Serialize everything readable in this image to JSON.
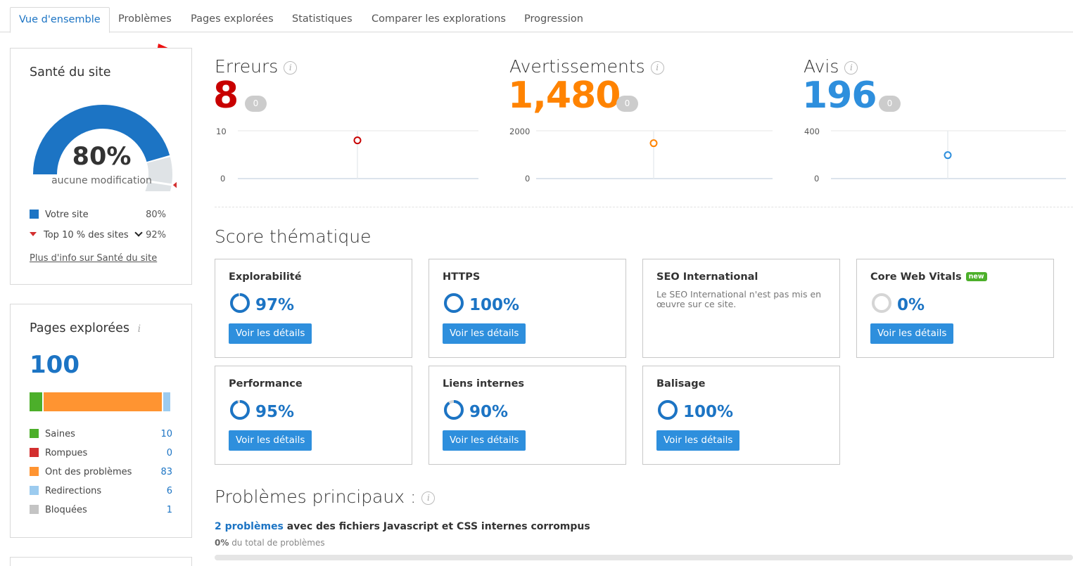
{
  "tabs": [
    {
      "label": "Vue d'ensemble"
    },
    {
      "label": "Problèmes"
    },
    {
      "label": "Pages explorées"
    },
    {
      "label": "Statistiques"
    },
    {
      "label": "Comparer les explorations"
    },
    {
      "label": "Progression"
    }
  ],
  "site_health": {
    "title": "Santé du site",
    "percent": "80%",
    "subtitle": "aucune modification",
    "gauge_value": 0.8,
    "top10_marker": 0.92,
    "legend": [
      {
        "label": "Votre site",
        "value": "80%"
      },
      {
        "label": "Top 10 % des sites",
        "value": "92%"
      }
    ],
    "more_link": "Plus d'info sur Santé du site",
    "colors": {
      "your_site": "#1c74c4",
      "top10": "#d32f2f",
      "remaining": "#dfe3e6"
    }
  },
  "crawled_pages": {
    "title": "Pages explorées",
    "total": "100",
    "bar": [
      {
        "label": "Saines",
        "value": 10,
        "color": "#4caf2a"
      },
      {
        "label": "Rompues",
        "value": 0,
        "color": "#d32f2f"
      },
      {
        "label": "Ont des problèmes",
        "value": 83,
        "color": "#ff9431"
      },
      {
        "label": "Redirections",
        "value": 6,
        "color": "#9ccbef"
      },
      {
        "label": "Bloquées",
        "value": 1,
        "color": "#c4c4c4"
      }
    ],
    "values_text": [
      "10",
      "0",
      "83",
      "6",
      "1"
    ]
  },
  "metrics": {
    "errors": {
      "title": "Erreurs",
      "value": "8",
      "delta": "0",
      "ymax": "10",
      "ymin": "0",
      "point": 8,
      "color": "#c80000"
    },
    "warnings": {
      "title": "Avertissements",
      "value": "1,480",
      "delta": "0",
      "ymax": "2000",
      "ymin": "0",
      "point": 1480,
      "color": "#ff8300"
    },
    "notices": {
      "title": "Avis",
      "value": "196",
      "delta": "0",
      "ymax": "400",
      "ymin": "0",
      "point": 196,
      "color": "#2e8fdd"
    }
  },
  "thematic": {
    "title": "Score thématique",
    "button_label": "Voir les détails",
    "cards": [
      {
        "name": "Explorabilité",
        "pct": "97%",
        "value": 0.97
      },
      {
        "name": "HTTPS",
        "pct": "100%",
        "value": 1.0
      },
      {
        "name": "SEO International",
        "text": "Le SEO International n'est pas mis en œuvre sur ce site."
      },
      {
        "name": "Core Web Vitals",
        "badge": "new",
        "pct": "0%",
        "value": 0.0
      },
      {
        "name": "Performance",
        "pct": "95%",
        "value": 0.95
      },
      {
        "name": "Liens internes",
        "pct": "90%",
        "value": 0.9
      },
      {
        "name": "Balisage",
        "pct": "100%",
        "value": 1.0
      }
    ]
  },
  "top_issues": {
    "title": "Problèmes principaux :",
    "issue_link": "2 problèmes",
    "issue_text": " avec des fichiers Javascript et CSS internes corrompus",
    "pct": "0%",
    "pct_text": " du total de problèmes"
  }
}
